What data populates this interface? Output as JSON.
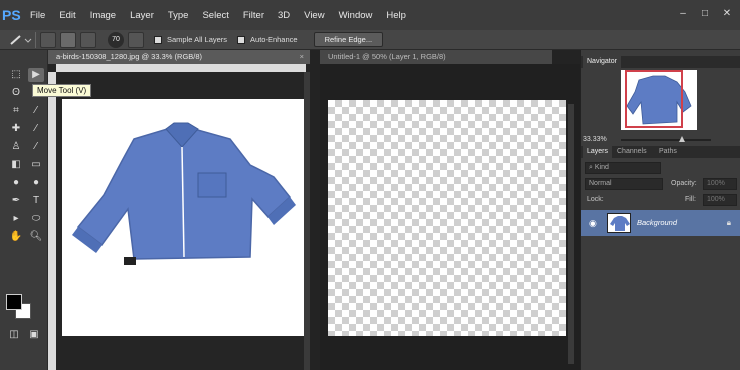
{
  "app": {
    "logo": "PS"
  },
  "menu": [
    "File",
    "Edit",
    "Image",
    "Layer",
    "Type",
    "Select",
    "Filter",
    "3D",
    "View",
    "Window",
    "Help"
  ],
  "window_controls": {
    "minimize": "–",
    "maximize": "□",
    "close": "✕"
  },
  "options_bar": {
    "brush_size": "70",
    "sample_all_layers": "Sample All Layers",
    "auto_enhance": "Auto-Enhance",
    "refine_edge": "Refine Edge..."
  },
  "tooltip": "Move Tool (V)",
  "documents": [
    {
      "tab": "a-birds-150308_1280.jpg @ 33.3% (RGB/8)"
    },
    {
      "tab": "Untitled-1 @ 50% (Layer 1, RGB/8)"
    }
  ],
  "navigator": {
    "tab": "Navigator",
    "zoom": "33.33%"
  },
  "layers_panel": {
    "tabs": [
      "Layers",
      "Channels",
      "Paths"
    ],
    "kind": "Kind",
    "blend_mode": "Normal",
    "opacity_label": "Opacity:",
    "opacity_value": "100%",
    "lock_label": "Lock:",
    "fill_label": "Fill:",
    "fill_value": "100%",
    "layers": [
      {
        "name": "Background"
      }
    ]
  },
  "colors": {
    "shirt": "#5d7cc4",
    "layer_selected": "#5974a3",
    "nav_frame": "#d0404a"
  }
}
